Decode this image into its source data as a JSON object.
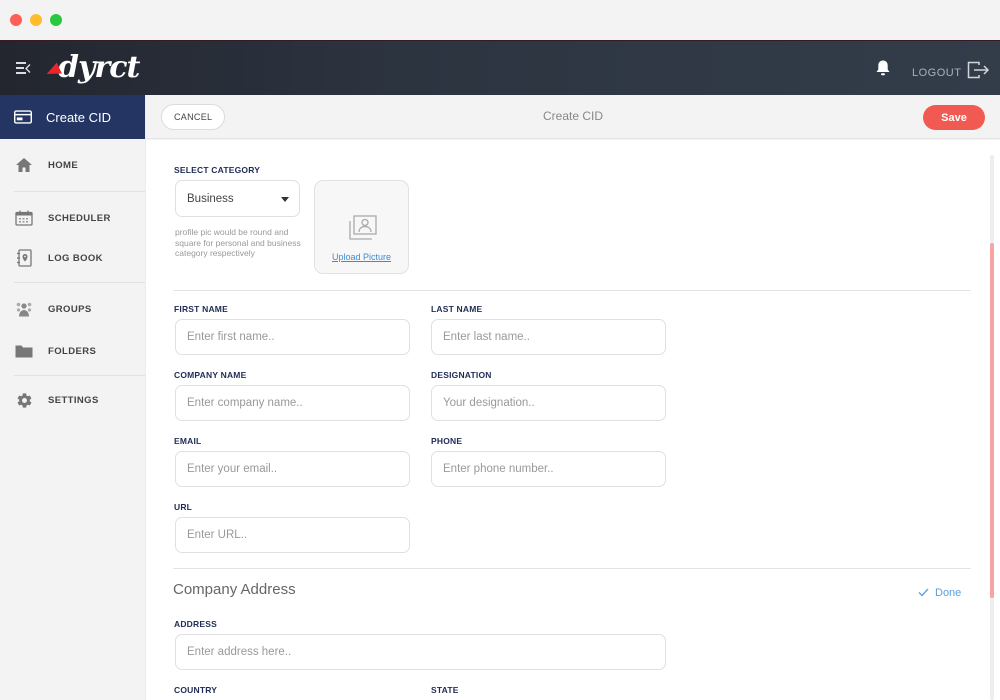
{
  "window": {
    "controls": [
      "close",
      "minimize",
      "maximize"
    ]
  },
  "topbar": {
    "menu_icon": "menu-collapse-icon",
    "logo_text": "dyrct",
    "notification_icon": "bell-icon",
    "logout_label": "LOGOUT",
    "logout_icon": "logout-icon"
  },
  "sidebar": {
    "active": {
      "label": "Create CID",
      "icon": "id-card-icon"
    },
    "items": [
      {
        "label": "HOME",
        "icon": "home-icon"
      },
      {
        "label": "SCHEDULER",
        "icon": "calendar-icon"
      },
      {
        "label": "LOG BOOK",
        "icon": "logbook-icon"
      },
      {
        "label": "GROUPS",
        "icon": "groups-icon"
      },
      {
        "label": "FOLDERS",
        "icon": "folder-icon"
      },
      {
        "label": "SETTINGS",
        "icon": "gear-icon"
      }
    ]
  },
  "toolbar": {
    "cancel_label": "CANCEL",
    "title": "Create CID",
    "save_label": "Save"
  },
  "form": {
    "category": {
      "label": "SELECT CATEGORY",
      "value": "Business",
      "hint": "profile pic would be round and square for personal and business category respectively"
    },
    "upload": {
      "label": "Upload Picture",
      "icon": "picture-icon"
    },
    "fields": {
      "first_name": {
        "label": "FIRST NAME",
        "placeholder": "Enter first name.."
      },
      "last_name": {
        "label": "LAST NAME",
        "placeholder": "Enter last name.."
      },
      "company_name": {
        "label": "COMPANY NAME",
        "placeholder": "Enter company name.."
      },
      "designation": {
        "label": "DESIGNATION",
        "placeholder": "Your designation.."
      },
      "email": {
        "label": "EMAIL",
        "placeholder": "Enter your email.."
      },
      "phone": {
        "label": "PHONE",
        "placeholder": "Enter phone number.."
      },
      "url": {
        "label": "URL",
        "placeholder": "Enter URL.."
      }
    },
    "address_section": {
      "title": "Company Address",
      "done_label": "Done",
      "address": {
        "label": "ADDRESS",
        "placeholder": "Enter address here.."
      },
      "country": {
        "label": "COUNTRY"
      },
      "state": {
        "label": "STATE"
      }
    }
  },
  "colors": {
    "accent_navy": "#243564",
    "save_red": "#f15a52",
    "link_blue": "#3f8ad6",
    "label_navy": "#1f2b56"
  }
}
